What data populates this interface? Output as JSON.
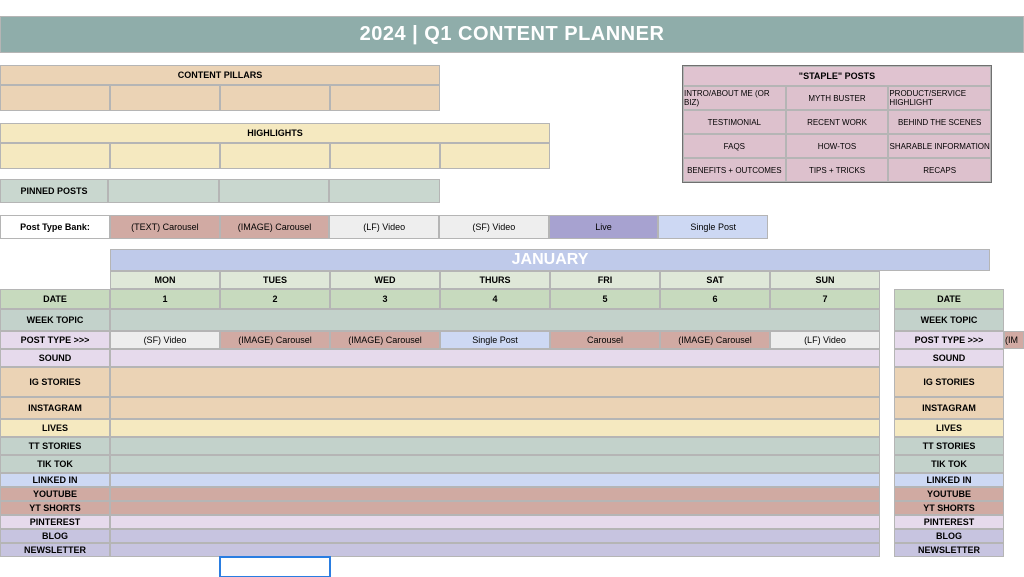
{
  "banner_title": "2024 | Q1 CONTENT PLANNER",
  "pillars": {
    "header": "CONTENT PILLARS",
    "cols": 4
  },
  "highlights": {
    "header": "HIGHLIGHTS",
    "cols": 5
  },
  "staple": {
    "header": "\"STAPLE\" POSTS",
    "rows": [
      [
        "INTRO/ABOUT ME (OR BIZ)",
        "MYTH BUSTER",
        "PRODUCT/SERVICE HIGHLIGHT"
      ],
      [
        "TESTIMONIAL",
        "RECENT WORK",
        "BEHIND THE SCENES"
      ],
      [
        "FAQS",
        "HOW-TOS",
        "SHARABLE INFORMATION"
      ],
      [
        "BENEFITS + OUTCOMES",
        "TIPS + TRICKS",
        "RECAPS"
      ]
    ]
  },
  "pinned_label": "PINNED POSTS",
  "post_type_bank": {
    "label": "Post Type Bank:",
    "types": [
      {
        "name": "(TEXT) Carousel",
        "color": "rose"
      },
      {
        "name": "(IMAGE) Carousel",
        "color": "rose"
      },
      {
        "name": "(LF) Video",
        "color": "grey-lt"
      },
      {
        "name": "(SF) Video",
        "color": "grey-lt"
      },
      {
        "name": "Live",
        "color": "purple"
      },
      {
        "name": "Single Post",
        "color": "blue-lt"
      }
    ]
  },
  "month": "JANUARY",
  "days_of_week": [
    "MON",
    "TUES",
    "WED",
    "THURS",
    "FRI",
    "SAT",
    "SUN"
  ],
  "dates": [
    "1",
    "2",
    "3",
    "4",
    "5",
    "6",
    "7"
  ],
  "row_labels": {
    "date": "DATE",
    "week_topic": "WEEK TOPIC",
    "post_type": "POST TYPE >>>",
    "sound": "SOUND",
    "ig_stories": "IG STORIES",
    "instagram": "INSTAGRAM",
    "lives": "LIVES",
    "tt_stories": "TT STORIES",
    "tik_tok": "TIK TOK",
    "linked_in": "LINKED IN",
    "youtube": "YOUTUBE",
    "yt_shorts": "YT SHORTS",
    "pinterest": "PINTEREST",
    "blog": "BLOG",
    "newsletter": "NEWSLETTER"
  },
  "post_types_week": [
    {
      "name": "(SF) Video",
      "color": "grey-lt"
    },
    {
      "name": "(IMAGE) Carousel",
      "color": "rose"
    },
    {
      "name": "(IMAGE) Carousel",
      "color": "rose"
    },
    {
      "name": "Single Post",
      "color": "blue-lt"
    },
    {
      "name": "Carousel",
      "color": "rose"
    },
    {
      "name": "(IMAGE) Carousel",
      "color": "rose"
    },
    {
      "name": "(LF) Video",
      "color": "grey-lt"
    }
  ],
  "right_peek_posttype": "(IM"
}
